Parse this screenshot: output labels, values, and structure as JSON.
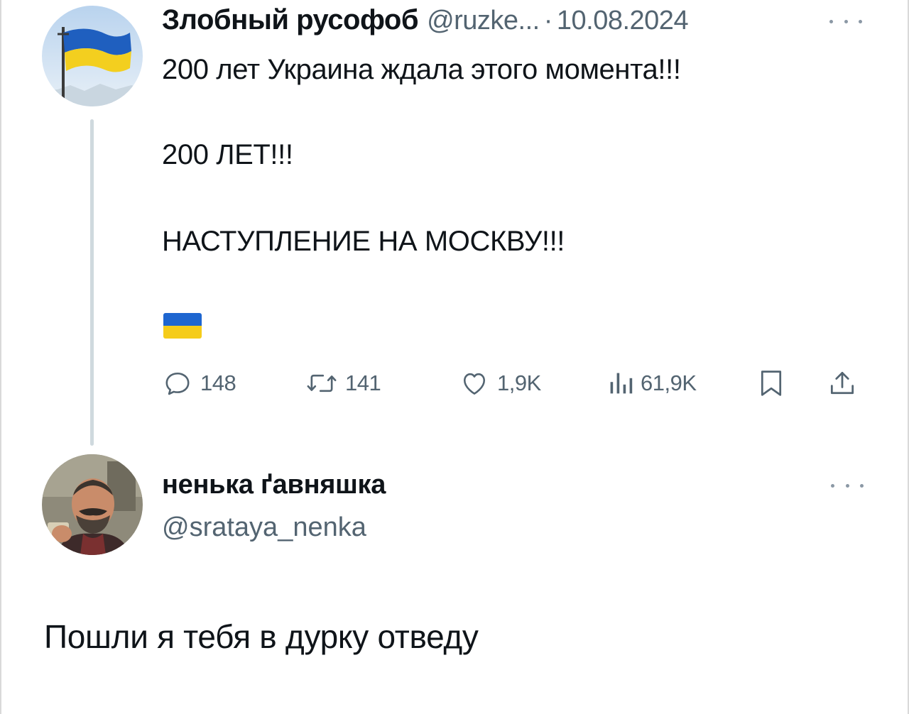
{
  "tweet": {
    "author_name": "Злобный русофоб",
    "author_handle": "@ruzke...",
    "separator": "·",
    "date": "10.08.2024",
    "lines": [
      "200 лет Украина ждала этого момента!!!",
      "200 ЛЕТ!!!",
      "НАСТУПЛЕНИЕ НА МОСКВУ!!!"
    ],
    "emoji": "ukraine-flag",
    "stats": {
      "replies": "148",
      "retweets": "141",
      "likes": "1,9K",
      "views": "61,9K"
    }
  },
  "reply": {
    "author_name": "ненька ґавняшка",
    "author_handle": "@srataya_nenka",
    "text": "Пошли я тебя в дурку отведу"
  },
  "colors": {
    "text_primary": "#0f1419",
    "text_secondary": "#536471",
    "thread_line": "#cfd9de",
    "flag_blue": "#1e66d0",
    "flag_yellow": "#f5cc1a"
  },
  "icons": [
    "reply-icon",
    "retweet-icon",
    "like-icon",
    "views-icon",
    "bookmark-icon",
    "share-icon",
    "more-icon"
  ]
}
